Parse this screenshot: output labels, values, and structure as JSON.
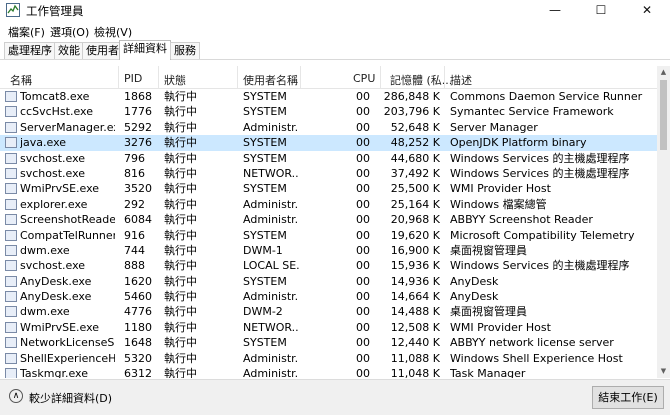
{
  "window": {
    "title": "工作管理員",
    "minimize": "—",
    "maximize": "☐",
    "close": "✕"
  },
  "menu": [
    "檔案(F)",
    "選項(O)",
    "檢視(V)"
  ],
  "tabs": [
    "處理程序",
    "效能",
    "使用者",
    "詳細資料",
    "服務"
  ],
  "active_tab": "詳細資料",
  "columns": {
    "name": "名稱",
    "pid": "PID",
    "status": "狀態",
    "user": "使用者名稱",
    "cpu": "CPU",
    "memory": "記憶體 (私...",
    "description": "描述"
  },
  "rows": [
    {
      "name": "Tomcat8.exe",
      "pid": "1868",
      "status": "執行中",
      "user": "SYSTEM",
      "cpu": "00",
      "memory": "286,848 K",
      "description": "Commons Daemon Service Runner",
      "icon": "tomcat-icon"
    },
    {
      "name": "ccSvcHst.exe",
      "pid": "1776",
      "status": "執行中",
      "user": "SYSTEM",
      "cpu": "00",
      "memory": "203,796 K",
      "description": "Symantec Service Framework",
      "icon": "symantec-icon"
    },
    {
      "name": "ServerManager.exe",
      "pid": "5292",
      "status": "執行中",
      "user": "Administr...",
      "cpu": "00",
      "memory": "52,648 K",
      "description": "Server Manager",
      "icon": "server-manager-icon"
    },
    {
      "name": "java.exe",
      "pid": "3276",
      "status": "執行中",
      "user": "SYSTEM",
      "cpu": "00",
      "memory": "48,252 K",
      "description": "OpenJDK Platform binary",
      "icon": "java-icon",
      "selected": true
    },
    {
      "name": "svchost.exe",
      "pid": "796",
      "status": "執行中",
      "user": "SYSTEM",
      "cpu": "00",
      "memory": "44,680 K",
      "description": "Windows Services 的主機處理程序",
      "icon": "service-host-icon"
    },
    {
      "name": "svchost.exe",
      "pid": "816",
      "status": "執行中",
      "user": "NETWOR...",
      "cpu": "00",
      "memory": "37,492 K",
      "description": "Windows Services 的主機處理程序",
      "icon": "service-host-icon"
    },
    {
      "name": "WmiPrvSE.exe",
      "pid": "3520",
      "status": "執行中",
      "user": "SYSTEM",
      "cpu": "00",
      "memory": "25,500 K",
      "description": "WMI Provider Host",
      "icon": "wmi-icon"
    },
    {
      "name": "explorer.exe",
      "pid": "292",
      "status": "執行中",
      "user": "Administr...",
      "cpu": "00",
      "memory": "25,164 K",
      "description": "Windows 檔案總管",
      "icon": "folder-icon"
    },
    {
      "name": "ScreenshotReader....",
      "pid": "6084",
      "status": "執行中",
      "user": "Administr...",
      "cpu": "00",
      "memory": "20,968 K",
      "description": "ABBYY Screenshot Reader",
      "icon": "screenshot-reader-icon"
    },
    {
      "name": "CompatTelRunner....",
      "pid": "916",
      "status": "執行中",
      "user": "SYSTEM",
      "cpu": "00",
      "memory": "19,620 K",
      "description": "Microsoft Compatibility Telemetry",
      "icon": "app-icon"
    },
    {
      "name": "dwm.exe",
      "pid": "744",
      "status": "執行中",
      "user": "DWM-1",
      "cpu": "00",
      "memory": "16,900 K",
      "description": "桌面視窗管理員",
      "icon": "app-icon"
    },
    {
      "name": "svchost.exe",
      "pid": "888",
      "status": "執行中",
      "user": "LOCAL SE...",
      "cpu": "00",
      "memory": "15,936 K",
      "description": "Windows Services 的主機處理程序",
      "icon": "service-host-icon"
    },
    {
      "name": "AnyDesk.exe",
      "pid": "1620",
      "status": "執行中",
      "user": "SYSTEM",
      "cpu": "00",
      "memory": "14,936 K",
      "description": "AnyDesk",
      "icon": "anydesk-icon"
    },
    {
      "name": "AnyDesk.exe",
      "pid": "5460",
      "status": "執行中",
      "user": "Administr...",
      "cpu": "00",
      "memory": "14,664 K",
      "description": "AnyDesk",
      "icon": "anydesk-icon"
    },
    {
      "name": "dwm.exe",
      "pid": "4776",
      "status": "執行中",
      "user": "DWM-2",
      "cpu": "00",
      "memory": "14,488 K",
      "description": "桌面視窗管理員",
      "icon": "app-icon"
    },
    {
      "name": "WmiPrvSE.exe",
      "pid": "1180",
      "status": "執行中",
      "user": "NETWOR...",
      "cpu": "00",
      "memory": "12,508 K",
      "description": "WMI Provider Host",
      "icon": "wmi-icon"
    },
    {
      "name": "NetworkLicenseSer...",
      "pid": "1648",
      "status": "執行中",
      "user": "SYSTEM",
      "cpu": "00",
      "memory": "12,440 K",
      "description": "ABBYY network license server",
      "icon": "app-icon"
    },
    {
      "name": "ShellExperienceHo...",
      "pid": "5320",
      "status": "執行中",
      "user": "Administr...",
      "cpu": "00",
      "memory": "11,088 K",
      "description": "Windows Shell Experience Host",
      "icon": "app-icon"
    },
    {
      "name": "Taskmgr.exe",
      "pid": "6312",
      "status": "執行中",
      "user": "Administr...",
      "cpu": "00",
      "memory": "11,048 K",
      "description": "Task Manager",
      "icon": "task-manager-icon"
    }
  ],
  "footer": {
    "less_details": "較少詳細資料(D)",
    "end_task": "結束工作(E)"
  },
  "colors": {
    "selected_row": "#cce8ff"
  }
}
